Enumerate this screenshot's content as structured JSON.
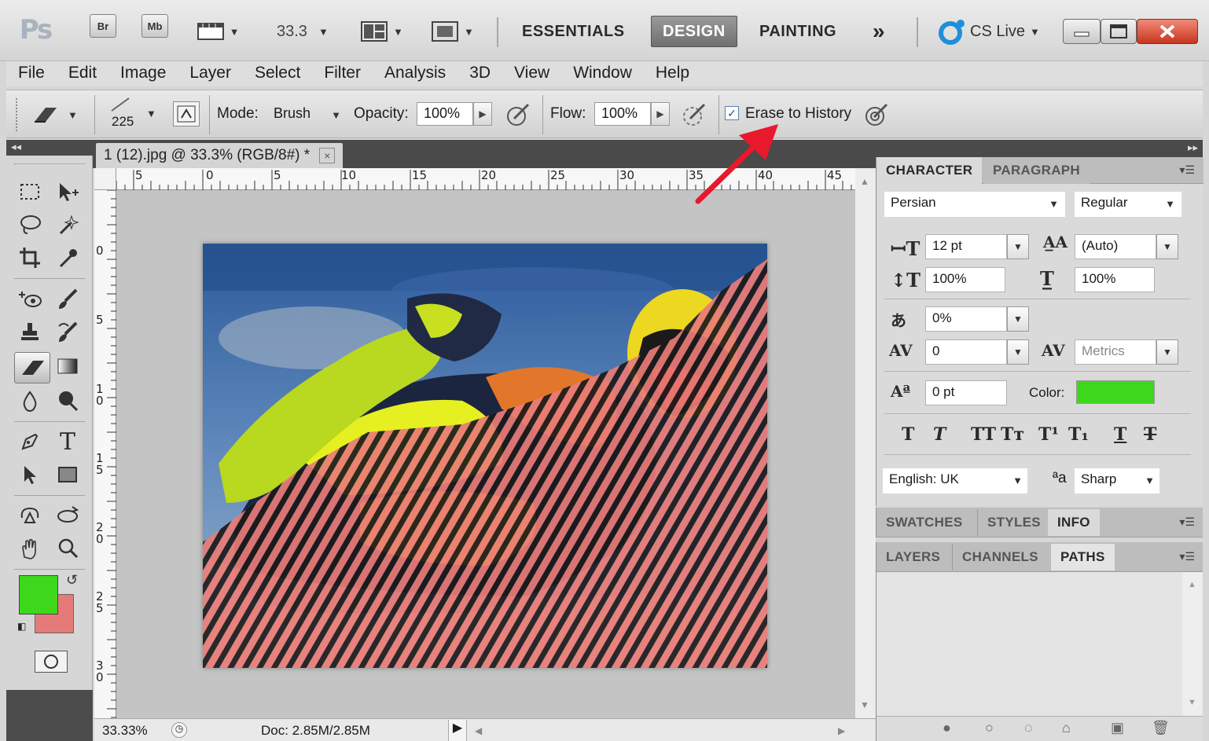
{
  "appbar": {
    "logo": "Ps",
    "bridge_label": "Br",
    "minibridge_label": "Mb",
    "zoom_value": "33.3",
    "workspaces": [
      "ESSENTIALS",
      "DESIGN",
      "PAINTING"
    ],
    "active_workspace": "DESIGN",
    "overflow": "»",
    "cslive_label": "CS Live"
  },
  "menu": [
    "File",
    "Edit",
    "Image",
    "Layer",
    "Select",
    "Filter",
    "Analysis",
    "3D",
    "View",
    "Window",
    "Help"
  ],
  "options": {
    "brush_size": "225",
    "mode_label": "Mode:",
    "mode_value": "Brush",
    "opacity_label": "Opacity:",
    "opacity_value": "100%",
    "flow_label": "Flow:",
    "flow_value": "100%",
    "erase_history_label": "Erase to History",
    "erase_history_checked": true
  },
  "document": {
    "tab_title": "1 (12).jpg @ 33.3% (RGB/8#) *",
    "close_glyph": "×",
    "ruler_top_labels": [
      "5",
      "0",
      "5",
      "10",
      "15",
      "20",
      "25",
      "30",
      "35",
      "40",
      "45"
    ],
    "ruler_left_labels": [
      "0",
      "5",
      "1\n0",
      "1\n5",
      "2\n0",
      "2\n5",
      "3\n0"
    ]
  },
  "status": {
    "zoom": "33.33%",
    "doc_size": "Doc: 2.85M/2.85M"
  },
  "colors": {
    "foreground": "#3dd81c",
    "background": "#e57b78",
    "annotation_arrow": "#e8182d",
    "character_color": "#3dd81c"
  },
  "character_panel": {
    "tabs": [
      "CHARACTER",
      "PARAGRAPH"
    ],
    "active_tab": "CHARACTER",
    "font_family": "Persian",
    "font_style": "Regular",
    "font_size": "12 pt",
    "leading": "(Auto)",
    "vertical_scale": "100%",
    "horizontal_scale": "100%",
    "tsume": "0%",
    "kerning": "0",
    "tracking": "Metrics",
    "baseline_shift": "0 pt",
    "color_label": "Color:",
    "language": "English: UK",
    "antialias": "Sharp",
    "antialias_icon_text": "ªa"
  },
  "panel_group_2": {
    "tabs": [
      "SWATCHES",
      "STYLES",
      "INFO"
    ],
    "active_tab": "INFO"
  },
  "panel_group_3": {
    "tabs": [
      "LAYERS",
      "CHANNELS",
      "PATHS"
    ],
    "active_tab": "PATHS"
  }
}
